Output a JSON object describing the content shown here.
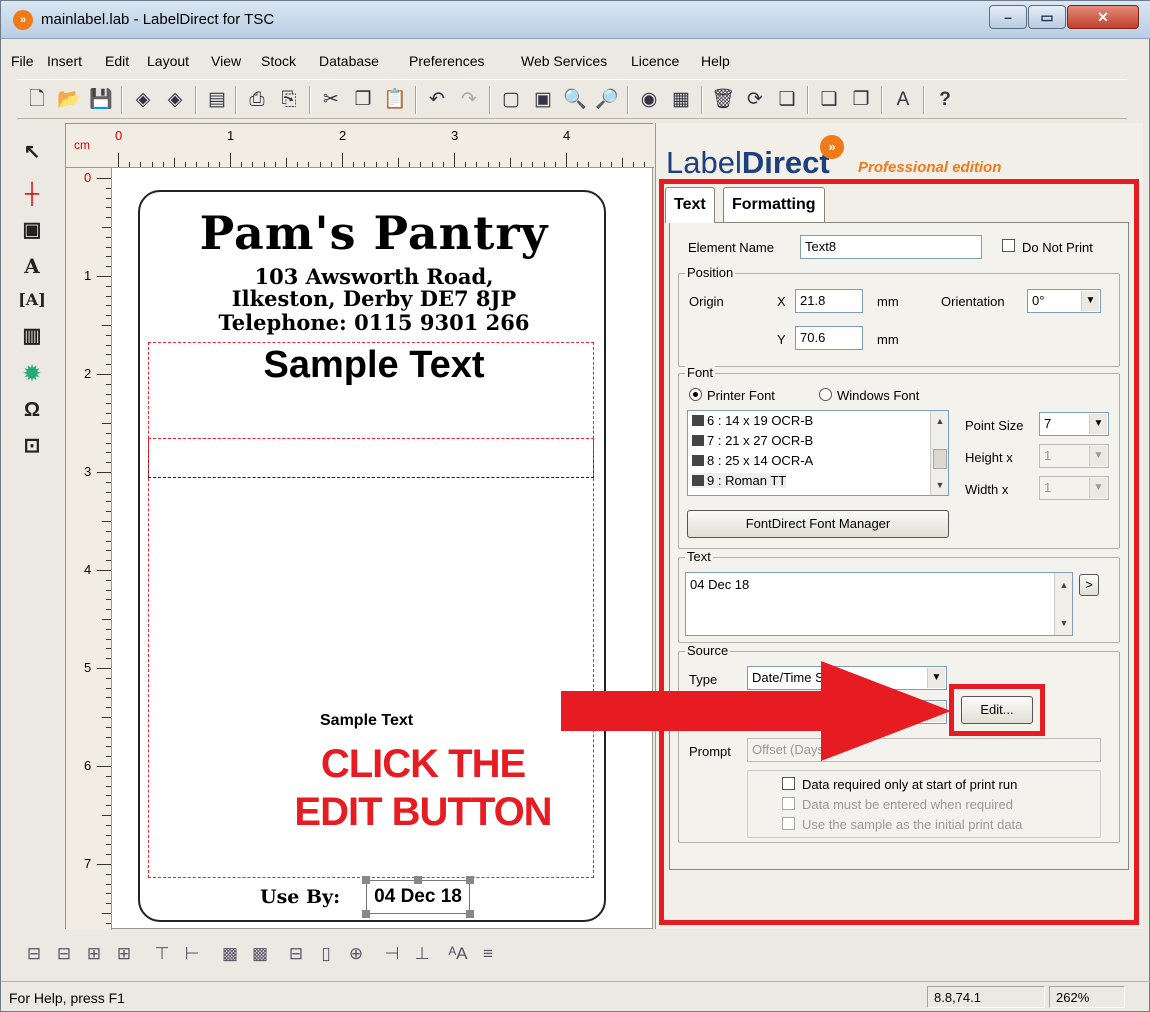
{
  "window": {
    "title": "mainlabel.lab - LabelDirect for TSC",
    "app_icon": "app-logo-icon"
  },
  "menu": [
    "File",
    "Insert",
    "Edit",
    "Layout",
    "View",
    "Stock",
    "Database",
    "Preferences",
    "Web Services",
    "Licence",
    "Help"
  ],
  "ruler": {
    "unit": "cm",
    "h_numbers": [
      "0",
      "1",
      "2",
      "3",
      "4"
    ],
    "v_numbers": [
      "0",
      "1",
      "2",
      "3",
      "4",
      "5",
      "6",
      "7"
    ]
  },
  "label": {
    "shop_name": "Pam's Pantry",
    "address_line1": "103 Awsworth Road,",
    "address_line2": "Ilkeston, Derby DE7 8JP",
    "telephone": "Telephone: 0115 9301 266",
    "sample_text_big": "Sample Text",
    "sample_text_small": "Sample Text",
    "use_by_label": "Use By:",
    "use_by_value": "04 Dec 18"
  },
  "callout": {
    "line1": "CLICK THE",
    "line2": "EDIT BUTTON",
    "color": "#e71c23"
  },
  "panel": {
    "brand_light": "Label",
    "brand_bold": "Direct",
    "edition": "Professional edition",
    "tabs": [
      "Text",
      "Formatting"
    ],
    "element_name_label": "Element Name",
    "element_name_value": "Text8",
    "do_not_print_label": "Do Not Print",
    "position_group": "Position",
    "origin_label": "Origin",
    "x_label": "X",
    "x_value": "21.8",
    "y_label": "Y",
    "y_value": "70.6",
    "unit_mm": "mm",
    "orientation_label": "Orientation",
    "orientation_value": "0°",
    "font_group": "Font",
    "printer_font_label": "Printer Font",
    "windows_font_label": "Windows Font",
    "font_list": [
      "6 : 14 x 19 OCR-B",
      "7 : 21 x 27 OCR-B",
      "8 : 25 x 14 OCR-A",
      "9 : Roman TT"
    ],
    "point_size_label": "Point Size",
    "point_size_value": "7",
    "height_label": "Height x",
    "height_value": "1",
    "width_label": "Width x",
    "width_value": "1",
    "font_manager_button": "FontDirect Font Manager",
    "text_group": "Text",
    "text_value": "04 Dec 18",
    "text_expand_button": ">",
    "source_group": "Source",
    "type_label": "Type",
    "type_value": "Date/Time Stamp",
    "edit_button": "Edit...",
    "prompt_label": "Prompt",
    "prompt_value": "Offset (Days)",
    "checks": [
      "Data required only at start of print run",
      "Data must be entered when required",
      "Use the sample as the initial print data"
    ]
  },
  "status": {
    "help_text": "For Help, press F1",
    "coords": "8.8,74.1",
    "zoom": "262%"
  }
}
